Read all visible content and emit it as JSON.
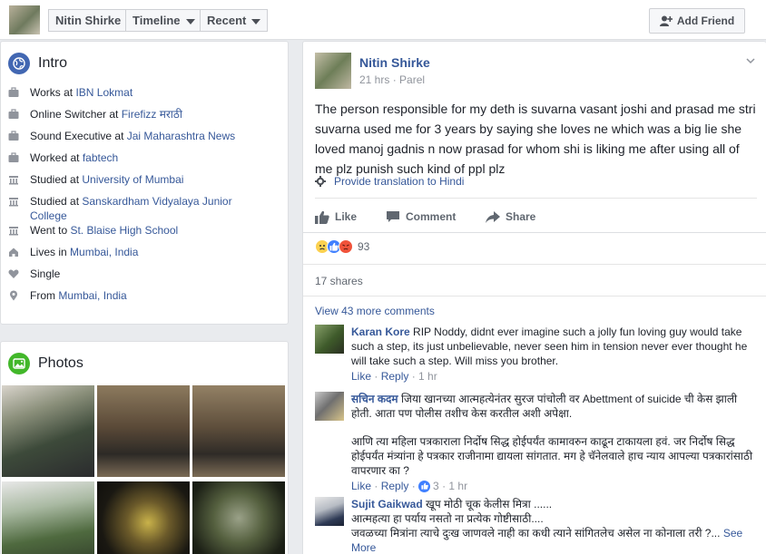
{
  "topbar": {
    "name_label": "Nitin Shirke",
    "timeline_label": "Timeline",
    "recent_label": "Recent",
    "add_friend_label": "Add Friend"
  },
  "intro": {
    "title": "Intro",
    "items": [
      {
        "icon": "briefcase-icon",
        "prefix": "Works at ",
        "link": "IBN Lokmat"
      },
      {
        "icon": "briefcase-icon",
        "prefix": "Online Switcher at ",
        "link": "Firefizz मराठी"
      },
      {
        "icon": "briefcase-icon",
        "prefix": "Sound Executive at ",
        "link": "Jai Maharashtra News"
      },
      {
        "icon": "briefcase-icon",
        "prefix": "Worked at ",
        "link": "fabtech"
      },
      {
        "icon": "graduation-cap-icon",
        "prefix": "Studied at ",
        "link": "University of Mumbai"
      },
      {
        "icon": "graduation-cap-icon",
        "prefix": "Studied at ",
        "link": "Sanskardham Vidyalaya Junior College"
      },
      {
        "icon": "graduation-cap-icon",
        "prefix": "Went to ",
        "link": "St. Blaise High School"
      },
      {
        "icon": "house-icon",
        "prefix": "Lives in ",
        "link": "Mumbai, India"
      },
      {
        "icon": "heart-icon",
        "prefix": "Single",
        "link": ""
      },
      {
        "icon": "location-pin-icon",
        "prefix": "From ",
        "link": "Mumbai, India"
      }
    ]
  },
  "photos": {
    "title": "Photos"
  },
  "post": {
    "author": "Nitin Shirke",
    "time": "21 hrs",
    "location": "Parel",
    "text": "The person responsible for my deth is suvarna vasant joshi and prasad me stri suvarna used me for 3 years by saying she loves ne which was a big lie she loved manoj gadnis n now prasad for whom shi is liking me after using all of me plz punish such kind of ppl plz",
    "translate_label": "Provide translation to Hindi",
    "like_label": "Like",
    "comment_label": "Comment",
    "share_label": "Share",
    "reaction_count": "93",
    "shares_label": "17 shares",
    "view_more_label": "View 43 more comments"
  },
  "comments": [
    {
      "name": "Karan Kore",
      "text": "RIP Noddy, didnt ever imagine such a jolly fun loving guy would take such a step, its just unbelievable, never seen him in tension never ever thought he will take such a step. Will miss you brother.",
      "like": "Like",
      "reply": "Reply",
      "time": "1 hr",
      "reactions": ""
    },
    {
      "name": "सचिन कदम",
      "text": "जिया खानच्या आत्महत्येनंतर सुरज पांचोली वर Abettment of suicide ची केस झाली होती. आता पण पोलीस तशीच केस करतील अशी अपेक्षा.",
      "text2": "आणि त्या महिला पत्रकाराला निर्दोष सिद्ध होईपर्यंत कामावरुन काढून टाकायला हवं. जर निर्दोष सिद्ध होईपर्यंत मंत्र्यांना हे पत्रकार राजीनामा द्यायला सांगतात. मग हे चॅनेलवाले हाच न्याय आपल्या पत्रकारांसाठी वापरणार का ?",
      "like": "Like",
      "reply": "Reply",
      "time": "1 hr",
      "reactions": "3"
    },
    {
      "name": "Sujit Gaikwad",
      "text": "खूप मोठी चूक केलीस मित्रा ......",
      "text2": "आत्महत्या हा पर्याय नसतो ना प्रत्येक गोष्टीसाठी....",
      "text3": "जवळच्या मित्रांना त्याचे दुःख जाणवले नाही का कधी त्याने सांगितलेच असेल ना कोनाला तरी ?...",
      "see_more": "See More"
    }
  ],
  "colors": {
    "link": "#365899",
    "muted": "#90949c",
    "like_blue": "#4080ff",
    "angry_orange": "#f0533a",
    "sad_yellow": "#fcd150"
  }
}
